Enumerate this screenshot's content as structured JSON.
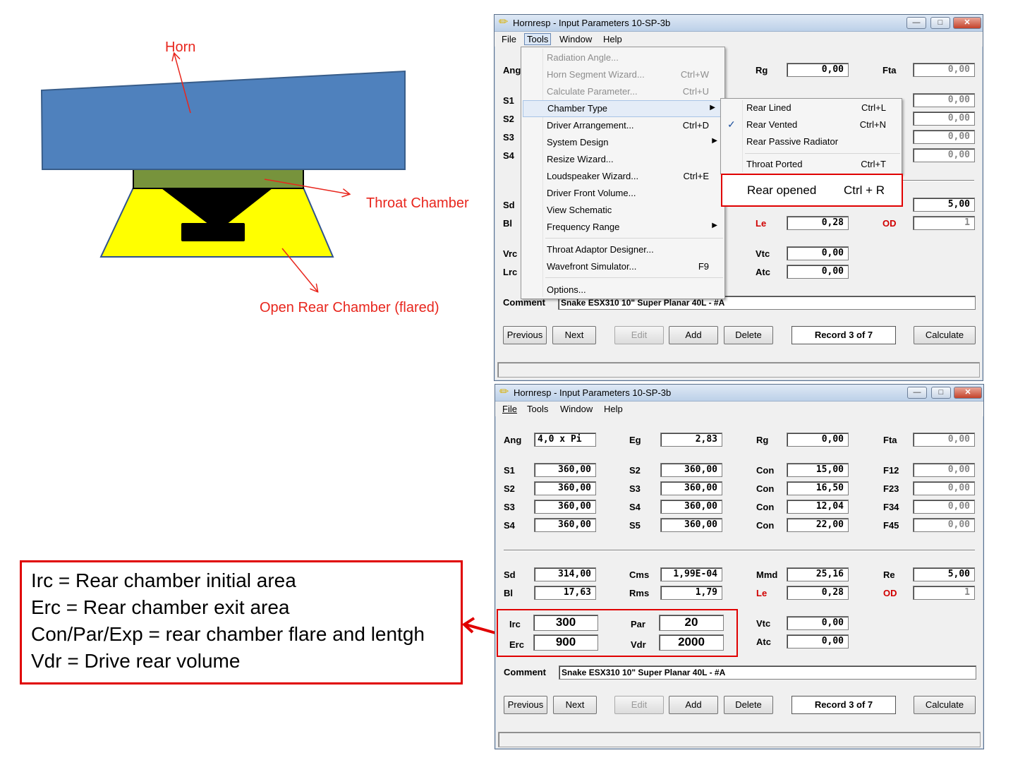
{
  "colors": {
    "annotation_red": "#e8261d",
    "horn_blue": "#4f81bd",
    "throat_green": "#77933c",
    "rear_yellow": "#ffff00"
  },
  "diagram": {
    "horn_label": "Horn",
    "throat_label": "Throat Chamber",
    "rear_label": "Open Rear Chamber (flared)"
  },
  "legend": {
    "lines": [
      "Irc = Rear chamber initial area",
      "Erc = Rear chamber exit area",
      "Con/Par/Exp = rear chamber flare and lentgh",
      "Vdr = Drive rear volume"
    ]
  },
  "window_top": {
    "title": "Hornresp - Input Parameters   10-SP-3b",
    "menus": [
      "File",
      "Tools",
      "Window",
      "Help"
    ],
    "labels": {
      "ang": "Ang",
      "s1": "S1",
      "s2": "S2",
      "s3": "S3",
      "s4": "S4",
      "sd": "Sd",
      "bl": "Bl",
      "vrc": "Vrc",
      "lrc": "Lrc",
      "rg": "Rg",
      "fta": "Fta",
      "le": "Le",
      "od": "OD",
      "vtc": "Vtc",
      "atc": "Atc",
      "comment": "Comment"
    },
    "values": {
      "rg": "0,00",
      "fta": "0,00",
      "f12": "0,00",
      "f23": "0,00",
      "f34": "0,00",
      "f45": "0,00",
      "re": "5,00",
      "le": "0,28",
      "od": "1",
      "vtc": "0,00",
      "atc": "0,00"
    },
    "comment": "Snake ESX310 10\" Super Planar 40L - #A",
    "tools_menu": [
      {
        "label": "Radiation Angle...",
        "shortcut": "",
        "disabled": true
      },
      {
        "label": "Horn Segment Wizard...",
        "shortcut": "Ctrl+W",
        "disabled": true
      },
      {
        "label": "Calculate Parameter...",
        "shortcut": "Ctrl+U",
        "disabled": true
      },
      {
        "label": "Chamber Type",
        "shortcut": "",
        "submenu": true
      },
      {
        "label": "Driver Arrangement...",
        "shortcut": "Ctrl+D"
      },
      {
        "label": "System Design",
        "shortcut": "",
        "submenu": true
      },
      {
        "label": "Resize Wizard...",
        "shortcut": ""
      },
      {
        "label": "Loudspeaker Wizard...",
        "shortcut": "Ctrl+E"
      },
      {
        "label": "Driver Front Volume...",
        "shortcut": ""
      },
      {
        "label": "View Schematic",
        "shortcut": ""
      },
      {
        "label": "Frequency Range",
        "shortcut": "",
        "submenu": true
      },
      {
        "label": "Throat Adaptor Designer...",
        "shortcut": ""
      },
      {
        "label": "Wavefront Simulator...",
        "shortcut": "F9"
      },
      {
        "label": "Options...",
        "shortcut": ""
      }
    ],
    "chamber_menu": [
      {
        "label": "Rear Lined",
        "shortcut": "Ctrl+L"
      },
      {
        "label": "Rear Vented",
        "shortcut": "Ctrl+N",
        "checked": true
      },
      {
        "label": "Rear Passive Radiator",
        "shortcut": ""
      },
      {
        "label": "Throat Ported",
        "shortcut": "Ctrl+T"
      }
    ],
    "added_item": {
      "label": "Rear opened",
      "shortcut": "Ctrl + R"
    },
    "buttons": {
      "previous": "Previous",
      "next": "Next",
      "edit": "Edit",
      "add": "Add",
      "delete": "Delete",
      "calculate": "Calculate"
    },
    "record": "Record 3 of 7"
  },
  "window_bottom": {
    "title": "Hornresp - Input Parameters   10-SP-3b",
    "menus": [
      "File",
      "Tools",
      "Window",
      "Help"
    ],
    "labels": {
      "ang": "Ang",
      "eg": "Eg",
      "rg": "Rg",
      "fta": "Fta",
      "s1": "S1",
      "s2": "S2",
      "s3": "S3",
      "s4": "S4",
      "c2": "S2",
      "c3": "S3",
      "c4": "S4",
      "c5": "S5",
      "con1": "Con",
      "con2": "Con",
      "con3": "Con",
      "con4": "Con",
      "f12": "F12",
      "f23": "F23",
      "f34": "F34",
      "f45": "F45",
      "sd": "Sd",
      "cms": "Cms",
      "mmd": "Mmd",
      "re": "Re",
      "bl": "Bl",
      "rms": "Rms",
      "le": "Le",
      "od": "OD",
      "irc": "Irc",
      "erc": "Erc",
      "par": "Par",
      "vdr": "Vdr",
      "vtc": "Vtc",
      "atc": "Atc",
      "comment": "Comment"
    },
    "values": {
      "ang": "4,0 x Pi",
      "eg": "2,83",
      "rg": "0,00",
      "fta": "0,00",
      "s1": "360,00",
      "s2": "360,00",
      "s3": "360,00",
      "s4": "360,00",
      "c2": "360,00",
      "c3": "360,00",
      "c4": "360,00",
      "c5": "360,00",
      "con1": "15,00",
      "con2": "16,50",
      "con3": "12,04",
      "con4": "22,00",
      "f12": "0,00",
      "f23": "0,00",
      "f34": "0,00",
      "f45": "0,00",
      "sd": "314,00",
      "cms": "1,99E-04",
      "mmd": "25,16",
      "re": "5,00",
      "bl": "17,63",
      "rms": "1,79",
      "le": "0,28",
      "od": "1",
      "irc": "300",
      "erc": "900",
      "par": "20",
      "vdr": "2000",
      "vtc": "0,00",
      "atc": "0,00"
    },
    "comment": "Snake ESX310 10\" Super Planar 40L - #A",
    "buttons": {
      "previous": "Previous",
      "next": "Next",
      "edit": "Edit",
      "add": "Add",
      "delete": "Delete",
      "calculate": "Calculate"
    },
    "record": "Record 3 of 7"
  }
}
